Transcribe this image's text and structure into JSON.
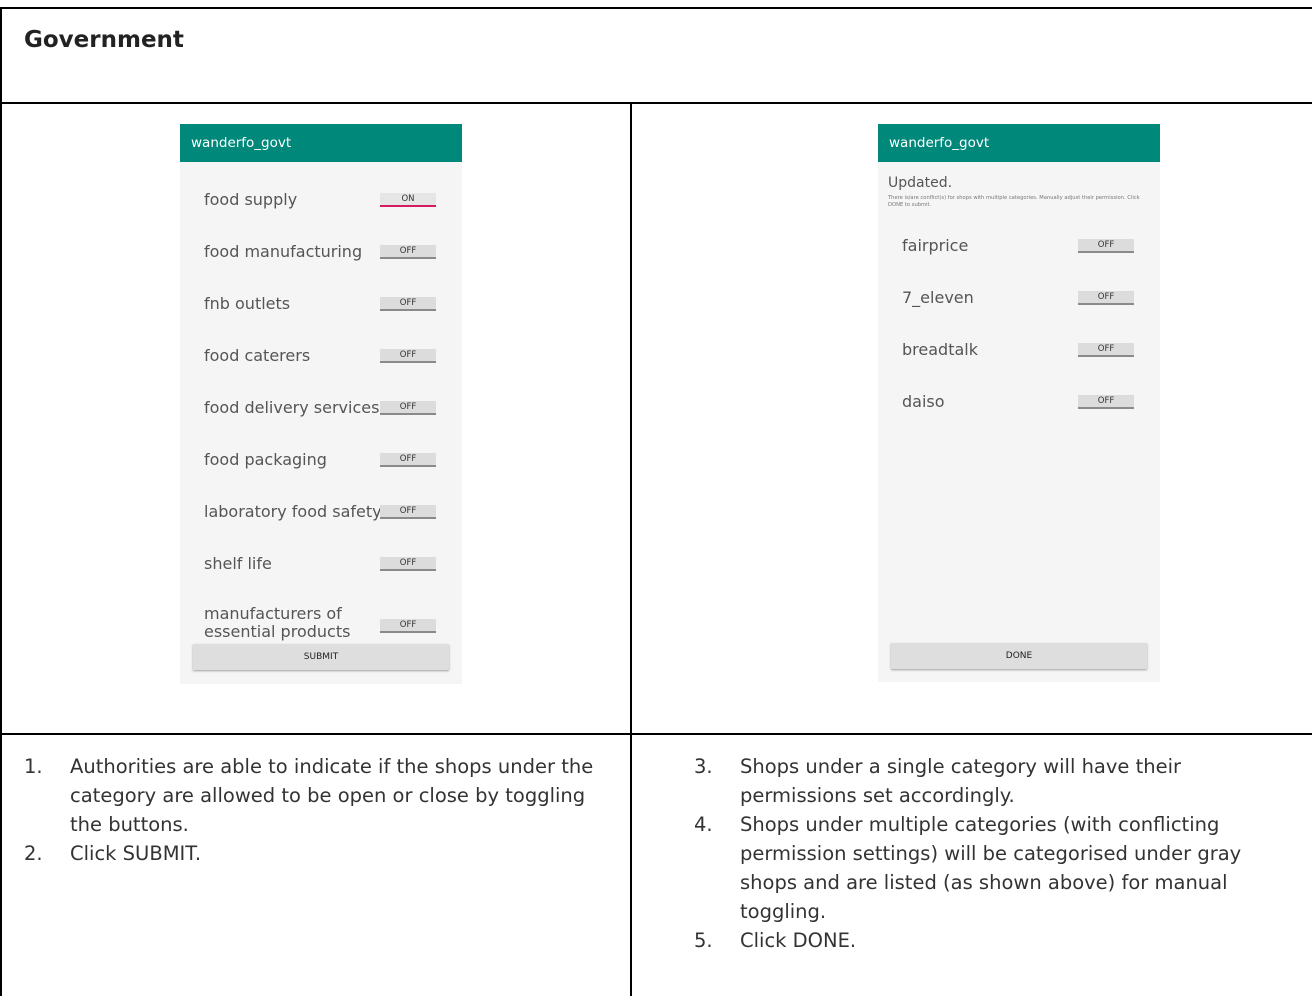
{
  "title": "Government",
  "left_phone": {
    "app_title": "wanderfo_govt",
    "categories": [
      {
        "label": "food supply",
        "state": "ON"
      },
      {
        "label": "food manufacturing",
        "state": "OFF"
      },
      {
        "label": "fnb outlets",
        "state": "OFF"
      },
      {
        "label": "food caterers",
        "state": "OFF"
      },
      {
        "label": "food delivery services",
        "state": "OFF"
      },
      {
        "label": "food packaging",
        "state": "OFF"
      },
      {
        "label": "laboratory food safety",
        "state": "OFF"
      },
      {
        "label": "shelf life",
        "state": "OFF"
      },
      {
        "label": "manufacturers of essential products",
        "state": "OFF"
      }
    ],
    "submit_label": "SUBMIT"
  },
  "right_phone": {
    "app_title": "wanderfo_govt",
    "status": "Updated.",
    "note": "There is/are conflict(s) for shops with multiple categories. Manually adjust their permission. Click DONE to submit.",
    "shops": [
      {
        "label": "fairprice",
        "state": "OFF"
      },
      {
        "label": "7_eleven",
        "state": "OFF"
      },
      {
        "label": "breadtalk",
        "state": "OFF"
      },
      {
        "label": "daiso",
        "state": "OFF"
      }
    ],
    "done_label": "DONE"
  },
  "steps_left": [
    {
      "num": "1.",
      "text": "Authorities are able to indicate if the shops under the category are allowed to be open or close by toggling the buttons."
    },
    {
      "num": "2.",
      "text": "Click SUBMIT."
    }
  ],
  "steps_right": [
    {
      "num": "3.",
      "text": "Shops under a single category will have their permissions set accordingly."
    },
    {
      "num": "4.",
      "text": "Shops under multiple categories (with conflicting permission settings) will be categorised under gray shops and are listed (as shown above) for manual toggling."
    },
    {
      "num": "5.",
      "text": "Click DONE."
    }
  ],
  "colors": {
    "app_bar": "#00897b",
    "toggle_on_accent": "#d81b60",
    "phone_bg": "#f5f5f5"
  }
}
